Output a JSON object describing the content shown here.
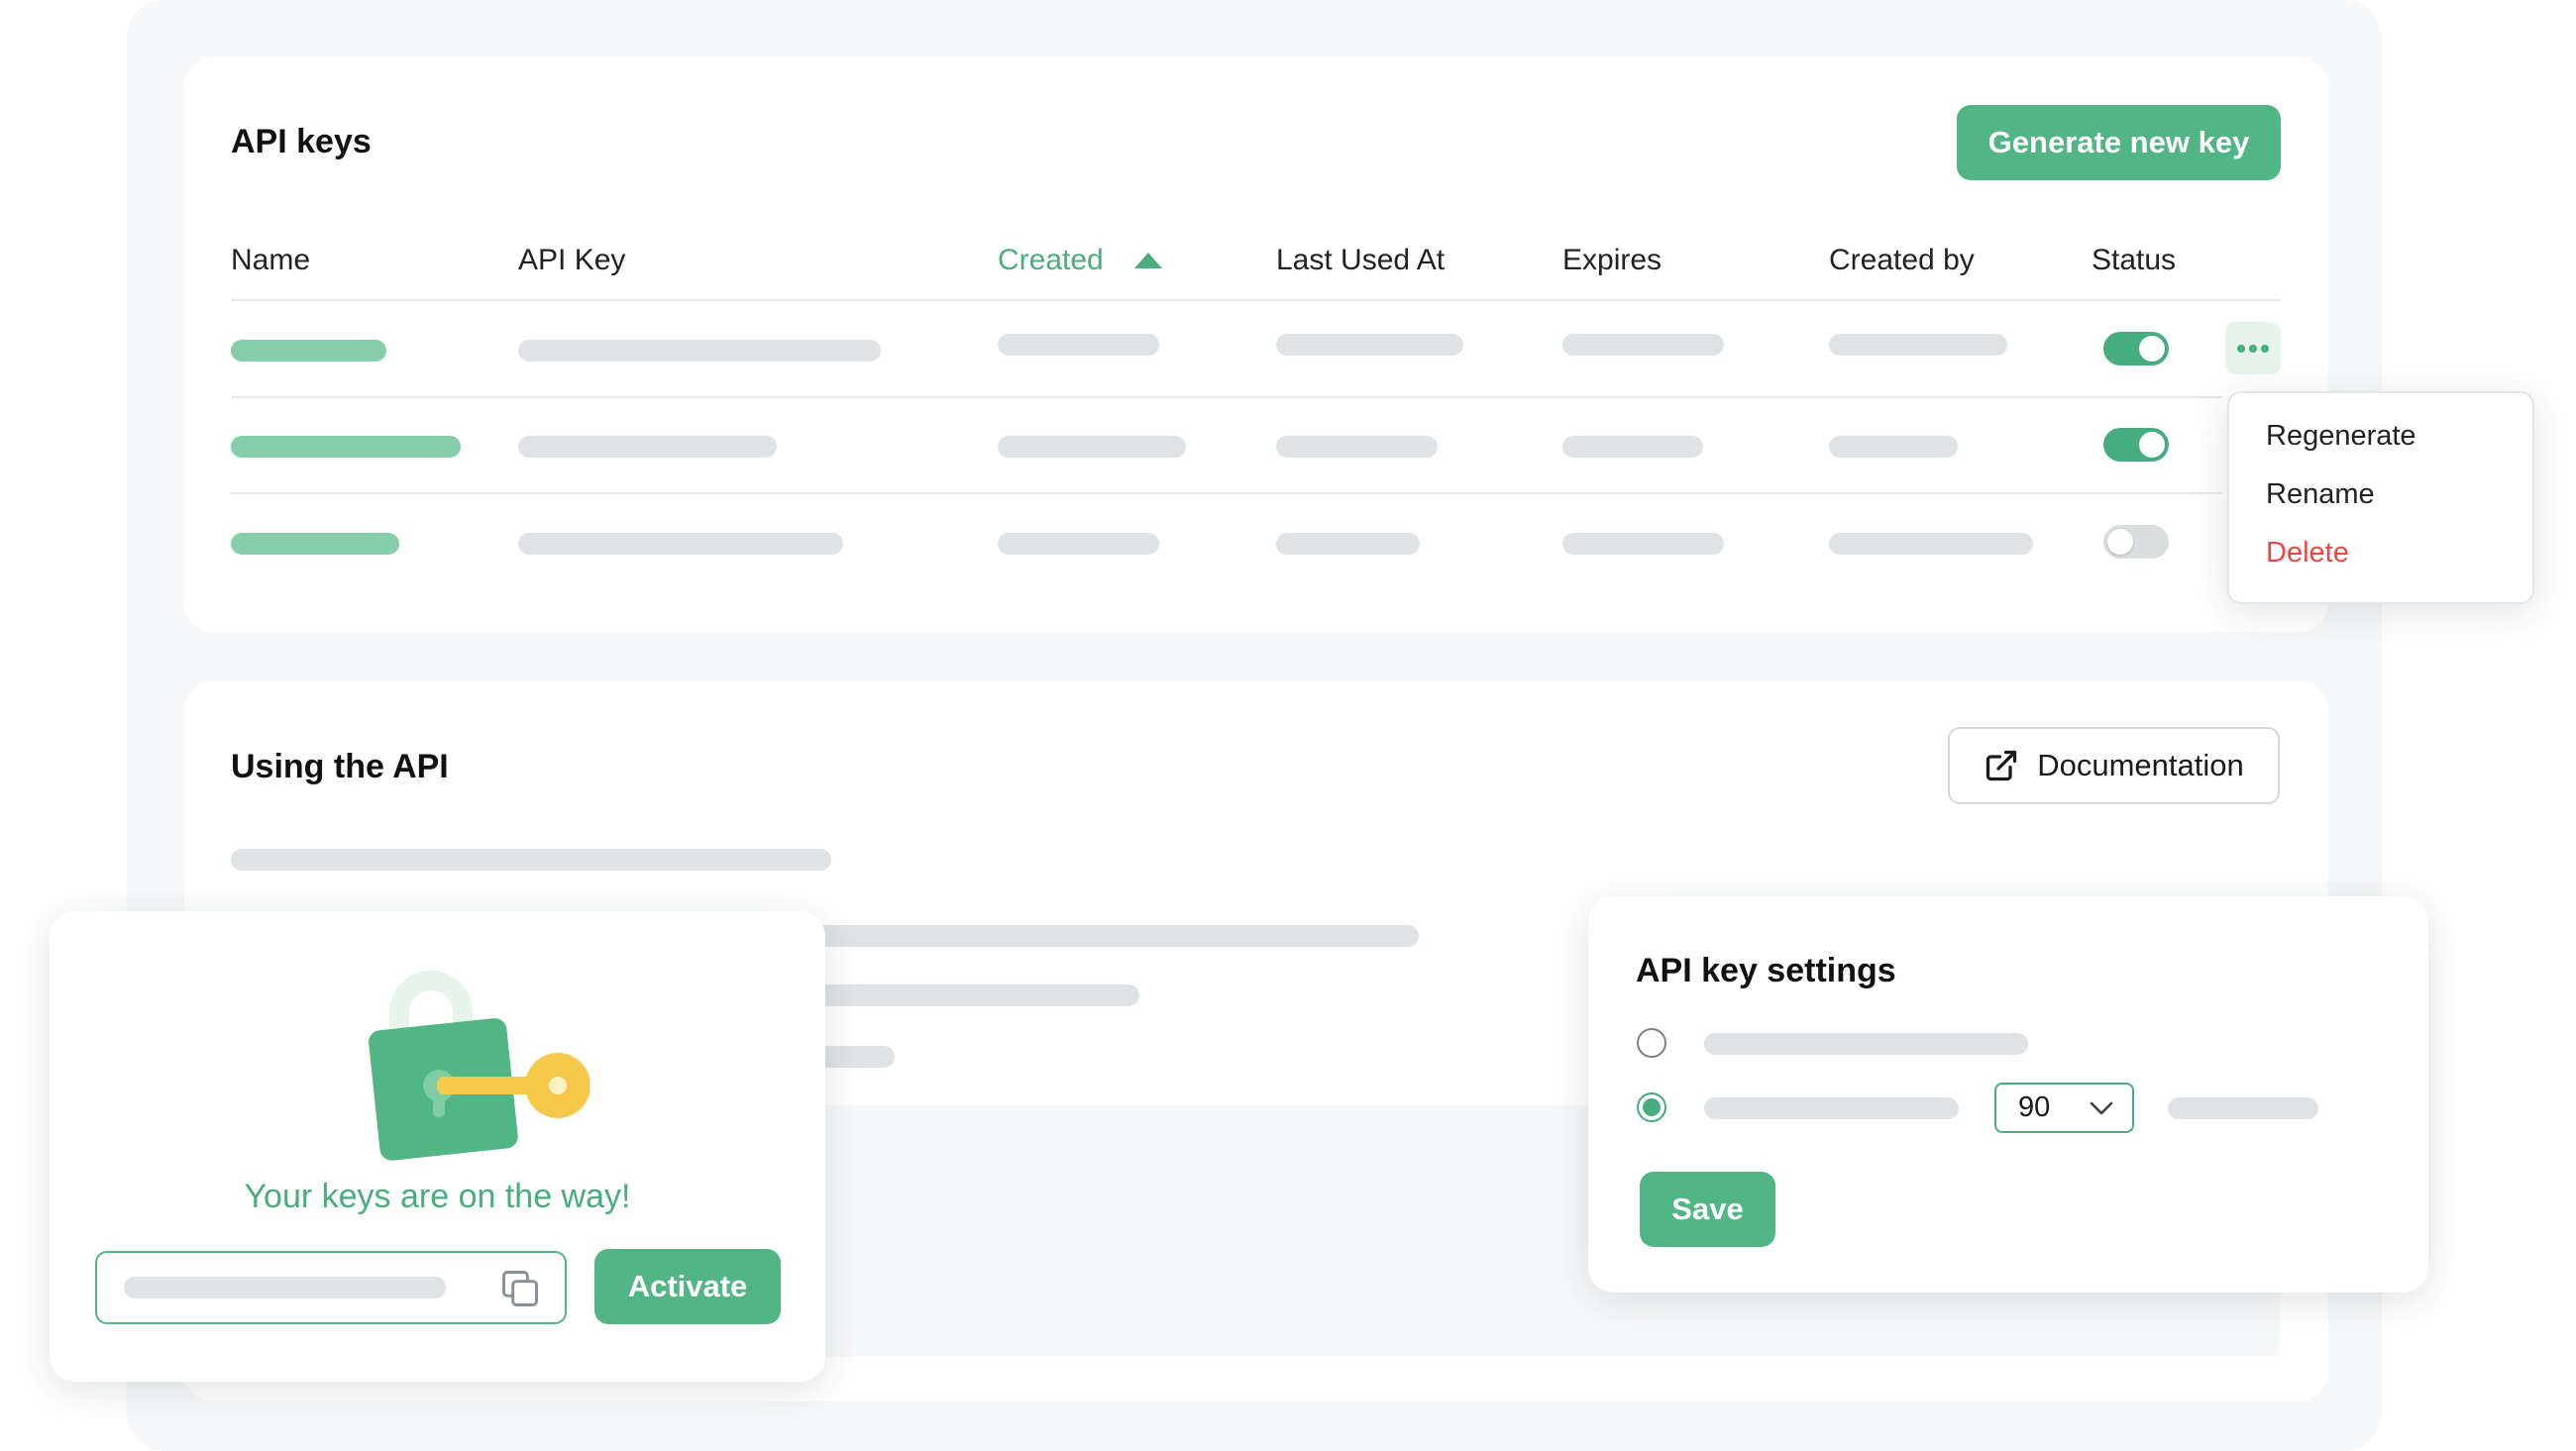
{
  "api_keys": {
    "title": "API keys",
    "generate_button": "Generate new key",
    "columns": {
      "name": "Name",
      "api_key": "API Key",
      "created": "Created",
      "last_used_at": "Last Used At",
      "expires": "Expires",
      "created_by": "Created by",
      "status": "Status"
    },
    "sorted_column": "created",
    "sort_direction": "ascending",
    "rows": [
      {
        "status": "on"
      },
      {
        "status": "on"
      },
      {
        "status": "off"
      }
    ],
    "row_menu": {
      "icon": "more-horizontal-icon",
      "items": [
        "Regenerate",
        "Rename",
        "Delete"
      ]
    }
  },
  "using_api": {
    "title": "Using the API",
    "documentation_button": "Documentation",
    "documentation_icon": "external-link-icon"
  },
  "keys_popup": {
    "icon": "lock-and-key-illustration",
    "message": "Your keys are on the way!",
    "copy_icon": "copy-icon",
    "activate_button": "Activate"
  },
  "settings": {
    "title": "API key settings",
    "selected_option": 2,
    "expiry_select_value": "90",
    "save_button": "Save"
  },
  "colors": {
    "accent": "#51b585",
    "accent_text": "#4aad7d",
    "danger": "#ef4444",
    "placeholder": "#dfe3e5",
    "placeholder_green": "#86ceaa",
    "key_yellow": "#f6c94a"
  }
}
